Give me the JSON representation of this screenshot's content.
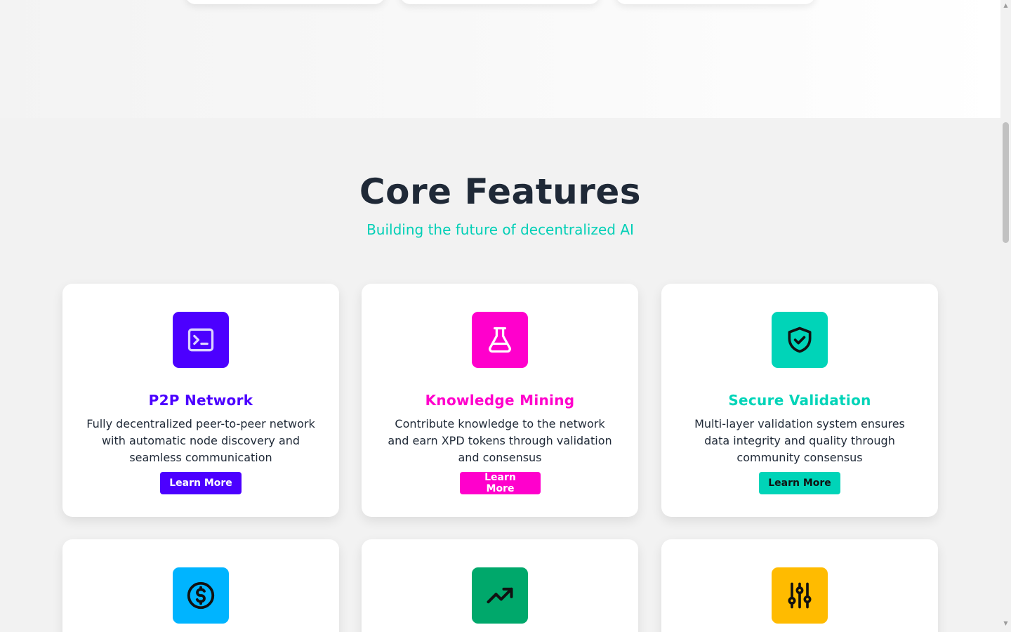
{
  "section": {
    "title": "Core Features",
    "subtitle": "Building the future of decentralized AI"
  },
  "cards": [
    {
      "title": "P2P Network",
      "description": "Fully decentralized peer-to-peer network with automatic node discovery and seamless communication",
      "button": "Learn More",
      "icon": "terminal-icon",
      "accent": "#4c00ff",
      "button_text_color": "#ffffff"
    },
    {
      "title": "Knowledge Mining",
      "description": "Contribute knowledge to the network and earn XPD tokens through validation and consensus",
      "button": "Learn More",
      "icon": "beaker-icon",
      "accent": "#ff00cc",
      "button_text_color": "#ffffff"
    },
    {
      "title": "Secure Validation",
      "description": "Multi-layer validation system ensures data integrity and quality through community consensus",
      "button": "Learn More",
      "icon": "shield-check-icon",
      "accent": "#00d4b8",
      "button_text_color": "#111111"
    },
    {
      "icon": "dollar-circle-icon",
      "accent": "#00b4ff"
    },
    {
      "icon": "trending-up-icon",
      "accent": "#00a86b"
    },
    {
      "icon": "sliders-icon",
      "accent": "#ffbb00"
    }
  ],
  "colors": {
    "background": "#f2f2f2",
    "heading": "#1f2937",
    "subtitle": "#00cfb6"
  }
}
